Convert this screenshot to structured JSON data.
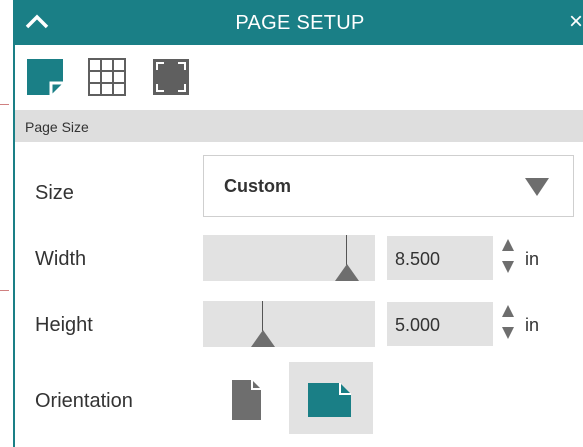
{
  "panel": {
    "title": "PAGE SETUP",
    "close_glyph": "×"
  },
  "toolbar": {
    "tools": [
      {
        "name": "page-size-tool",
        "icon": "page-corner-icon",
        "active": true
      },
      {
        "name": "grid-tool",
        "icon": "grid-icon",
        "active": false
      },
      {
        "name": "margins-tool",
        "icon": "margins-icon",
        "active": false
      }
    ]
  },
  "section": {
    "label": "Page Size"
  },
  "size": {
    "label": "Size",
    "value": "Custom"
  },
  "width": {
    "label": "Width",
    "value": "8.500",
    "unit": "in"
  },
  "height": {
    "label": "Height",
    "value": "5.000",
    "unit": "in"
  },
  "orientation": {
    "label": "Orientation",
    "options": [
      "portrait",
      "landscape"
    ],
    "selected": "landscape"
  },
  "colors": {
    "accent": "#1a7f86",
    "inactive_icon": "#5f5f5f",
    "field_bg": "#e2e2e2",
    "section_bg": "#dedede"
  }
}
